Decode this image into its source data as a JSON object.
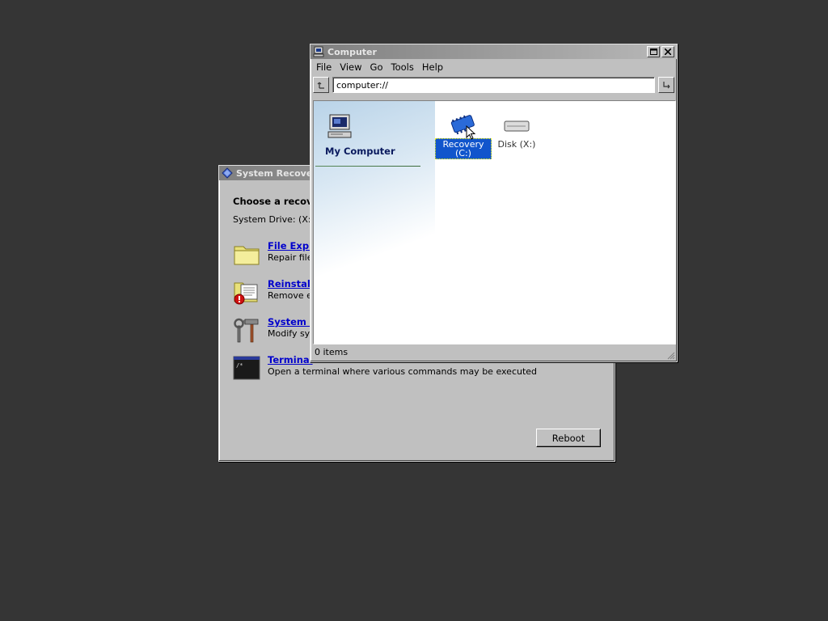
{
  "recovery_window": {
    "title": "System Recovery",
    "heading": "Choose a recovery tool",
    "system_drive": "System Drive: (X:/)",
    "options": [
      {
        "icon": "folder-icon",
        "title": "File Explorer",
        "description": "Repair files"
      },
      {
        "icon": "reinstall-icon",
        "title": "Reinstall",
        "description": "Remove ev"
      },
      {
        "icon": "tools-icon",
        "title": "System F",
        "description": "Modify sys"
      },
      {
        "icon": "terminal-icon",
        "title": "Terminal",
        "description": "Open a terminal where various commands may be executed"
      }
    ],
    "reboot_label": "Reboot"
  },
  "computer_window": {
    "title": "Computer",
    "menu": [
      "File",
      "View",
      "Go",
      "Tools",
      "Help"
    ],
    "address": "computer://",
    "side_panel_title": "My Computer",
    "drives": [
      {
        "label": "Recovery (C:)",
        "icon": "chip-drive-icon",
        "selected": true
      },
      {
        "label": "Disk (X:)",
        "icon": "disk-drive-icon",
        "selected": false
      }
    ],
    "status": "0 items"
  },
  "colors": {
    "desktop": "#353535",
    "window_face": "#c0c0c0",
    "selection": "#1155cc",
    "link": "#0000cc"
  }
}
